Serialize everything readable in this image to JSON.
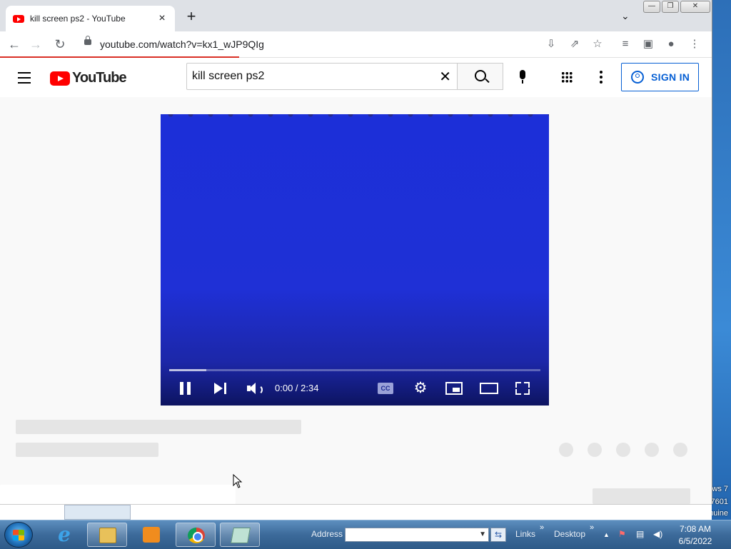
{
  "browser": {
    "tab_title": "kill screen ps2 - YouTube",
    "tab_close": "×",
    "new_tab": "+",
    "tab_search": "⌄",
    "window_buttons": [
      "—",
      "❐",
      "✕"
    ],
    "url": "youtube.com/watch?v=kx1_wJP9QIg",
    "nav": {
      "back": "←",
      "forward": "→",
      "reload": "↻"
    },
    "toolbar_icons": [
      "install-icon",
      "share-icon",
      "star-icon",
      "media-icon",
      "sidepanel-icon",
      "profile-icon",
      "menu-icon"
    ]
  },
  "youtube": {
    "logo_text": "YouTube",
    "search_query": "kill screen ps2",
    "clear": "✕",
    "sign_in": "SIGN IN",
    "brand_color": "#ff0000",
    "accent_color": "#065fd4"
  },
  "player": {
    "time": "0:00 / 2:34",
    "progress_fraction": 0.1,
    "cc_label": "CC",
    "settings": "⚙"
  },
  "desktop": {
    "watermark_line1": "ws 7",
    "watermark_line2": "7601",
    "watermark_line3": "not genuine"
  },
  "taskbar": {
    "address_label": "Address",
    "address_value": "",
    "links_label": "Links",
    "desktop_label": "Desktop",
    "chevron": "»",
    "tray_arrow": "▲",
    "time": "7:08 AM",
    "date": "6/5/2022"
  }
}
